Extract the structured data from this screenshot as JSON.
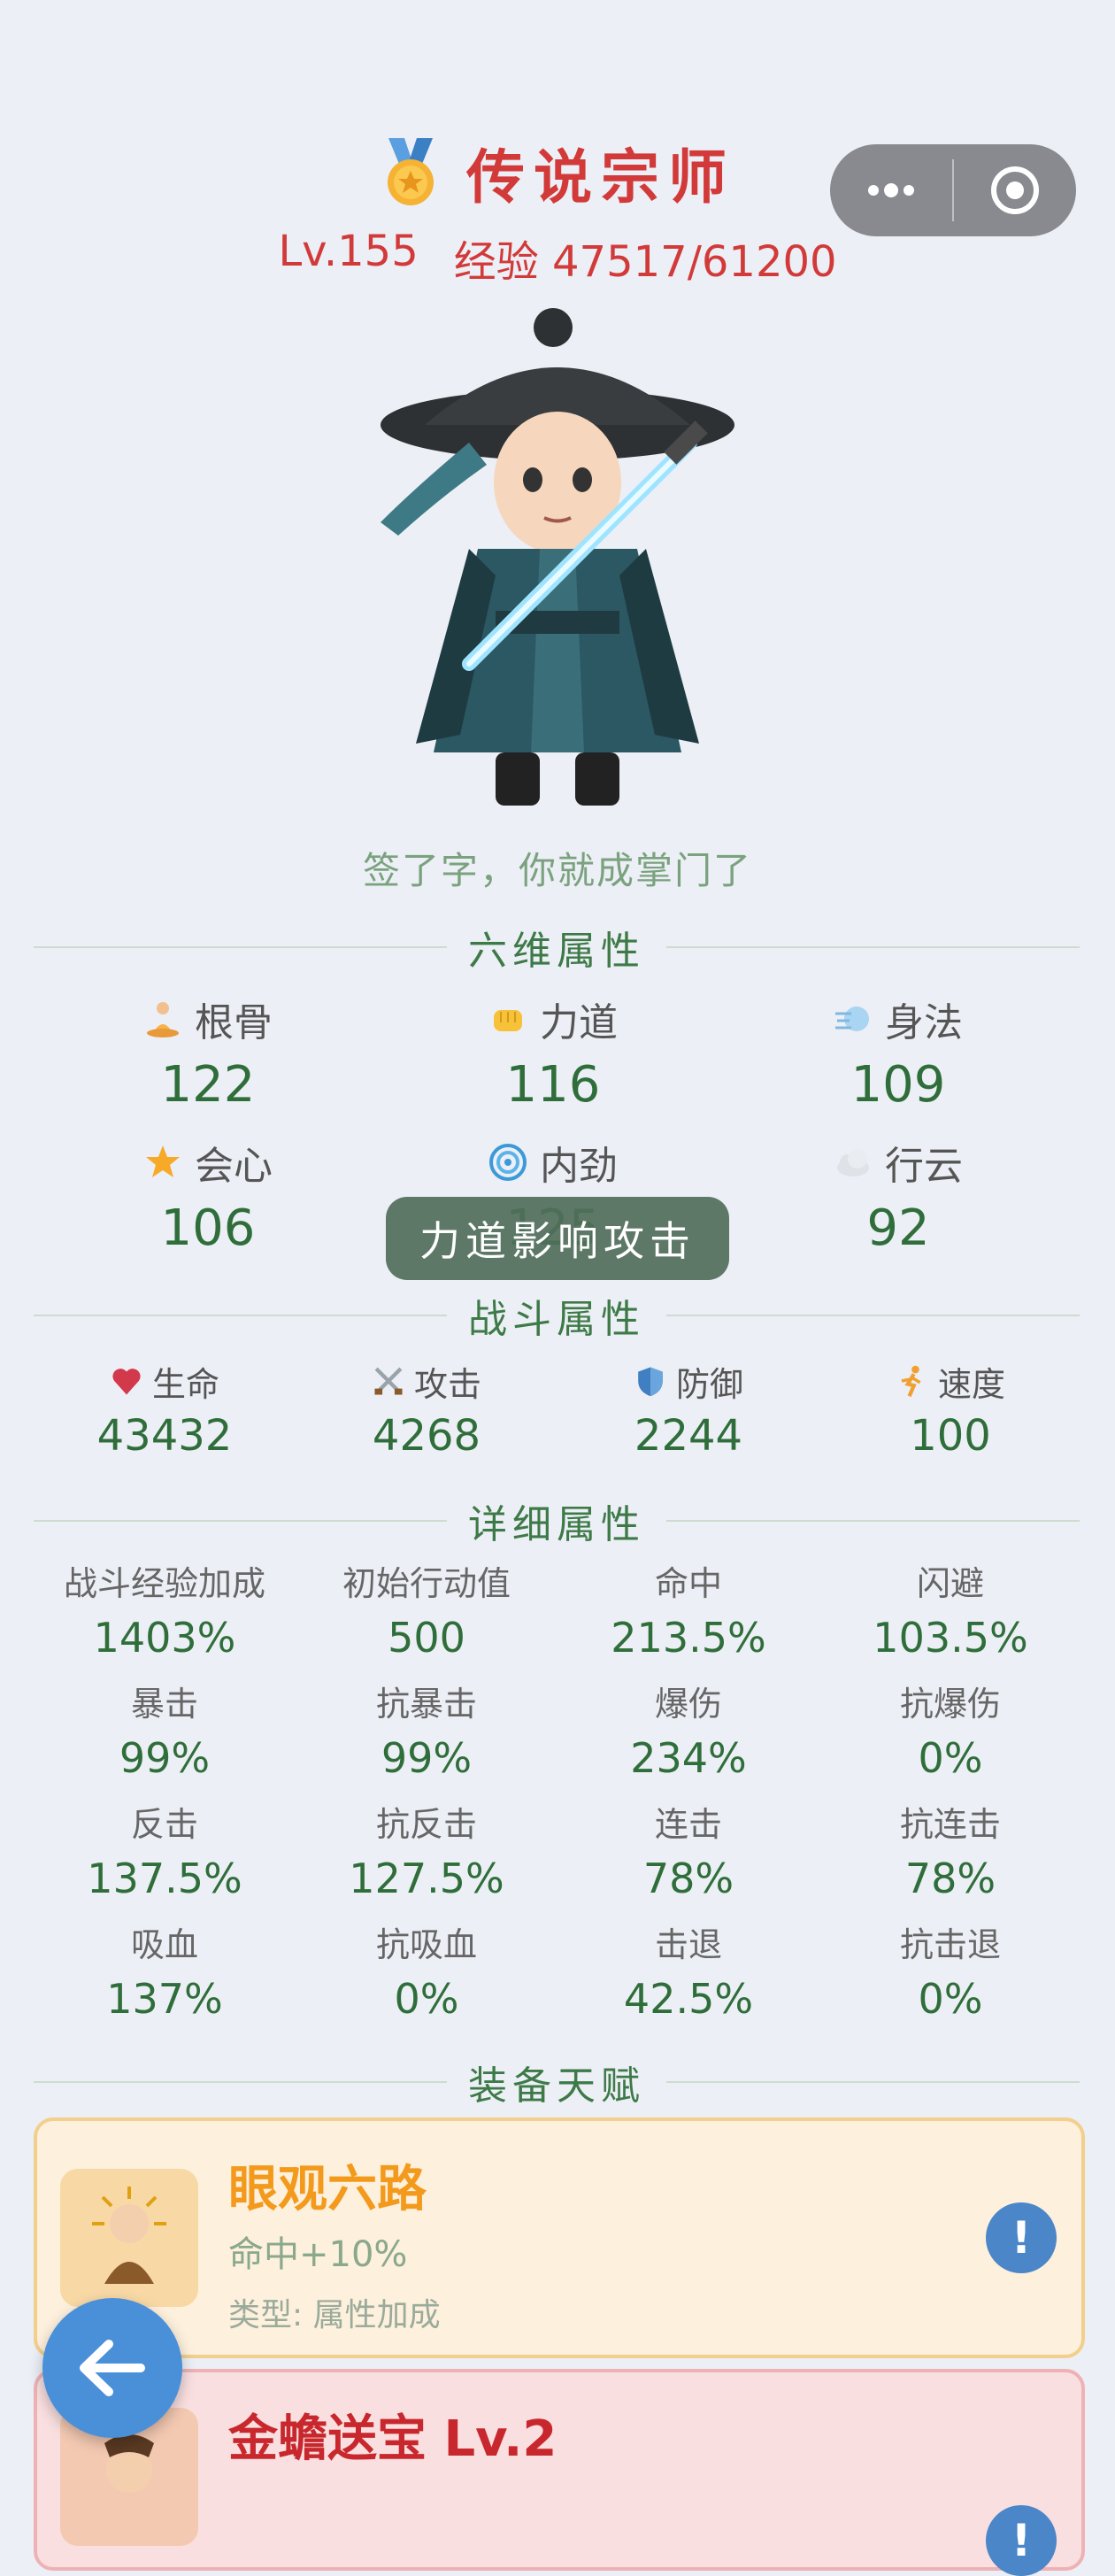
{
  "header": {
    "rank_title": "传说宗师",
    "level": "Lv.155",
    "experience": "经验 47517/61200"
  },
  "motto": "签了字，你就成掌门了",
  "sections": {
    "six_attributes": "六维属性",
    "combat_attributes": "战斗属性",
    "detailed_attributes": "详细属性",
    "equipped_talents": "装备天赋"
  },
  "six_attributes": [
    {
      "label": "根骨",
      "value": "122",
      "icon": "meditation-icon"
    },
    {
      "label": "力道",
      "value": "116",
      "icon": "fist-icon"
    },
    {
      "label": "身法",
      "value": "109",
      "icon": "wind-icon"
    },
    {
      "label": "会心",
      "value": "106",
      "icon": "star-icon"
    },
    {
      "label": "内劲",
      "value": "125",
      "icon": "swirl-icon"
    },
    {
      "label": "行云",
      "value": "92",
      "icon": "cloud-icon"
    }
  ],
  "tooltip": "力道影响攻击",
  "combat_attributes": [
    {
      "label": "生命",
      "value": "43432",
      "icon": "heart-icon"
    },
    {
      "label": "攻击",
      "value": "4268",
      "icon": "crossed-swords-icon"
    },
    {
      "label": "防御",
      "value": "2244",
      "icon": "shield-icon"
    },
    {
      "label": "速度",
      "value": "100",
      "icon": "runner-icon"
    }
  ],
  "detailed_attributes": [
    {
      "label": "战斗经验加成",
      "value": "1403%"
    },
    {
      "label": "初始行动值",
      "value": "500"
    },
    {
      "label": "命中",
      "value": "213.5%"
    },
    {
      "label": "闪避",
      "value": "103.5%"
    },
    {
      "label": "暴击",
      "value": "99%"
    },
    {
      "label": "抗暴击",
      "value": "99%"
    },
    {
      "label": "爆伤",
      "value": "234%"
    },
    {
      "label": "抗爆伤",
      "value": "0%"
    },
    {
      "label": "反击",
      "value": "137.5%"
    },
    {
      "label": "抗反击",
      "value": "127.5%"
    },
    {
      "label": "连击",
      "value": "78%"
    },
    {
      "label": "抗连击",
      "value": "78%"
    },
    {
      "label": "吸血",
      "value": "137%"
    },
    {
      "label": "抗吸血",
      "value": "0%"
    },
    {
      "label": "击退",
      "value": "42.5%"
    },
    {
      "label": "抗击退",
      "value": "0%"
    }
  ],
  "talents": [
    {
      "name": "眼观六路",
      "desc": "命中+10%",
      "type": "类型: 属性加成",
      "color": "#f39a1d",
      "info": "!"
    },
    {
      "name": "金蟾送宝  Lv.2",
      "color": "#c8282d",
      "info": "!"
    }
  ],
  "colors": {
    "accent_red": "#d23a3a",
    "value_green": "#2f6e3a",
    "section_green": "#3d7a47",
    "back_button": "#4a90d9"
  }
}
